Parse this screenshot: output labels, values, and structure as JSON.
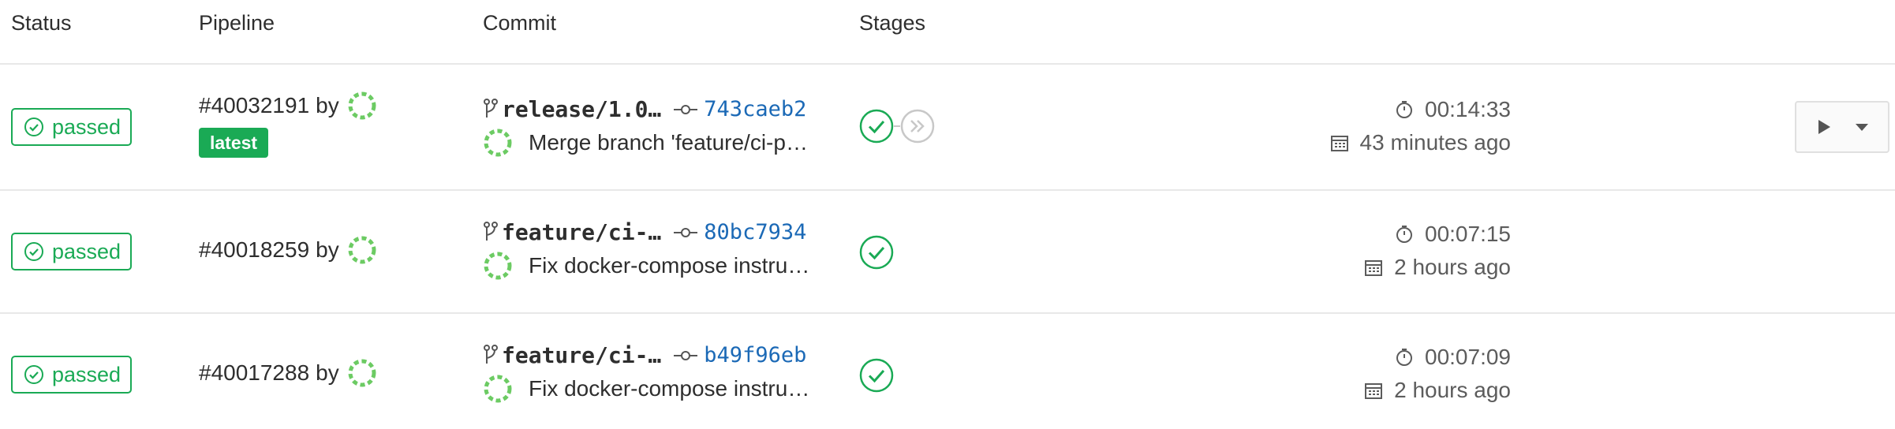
{
  "headers": {
    "status": "Status",
    "pipeline": "Pipeline",
    "commit": "Commit",
    "stages": "Stages"
  },
  "colors": {
    "success": "#1aaa55",
    "link": "#1b69b6",
    "muted": "#5c5c5c",
    "border": "#e8e8e8"
  },
  "rows": [
    {
      "status": "passed",
      "pipeline_id": "#40032191",
      "by": "by",
      "latest_label": "latest",
      "branch": "release/1.0…",
      "sha": "743caeb2",
      "message": "Merge branch 'feature/ci-p…",
      "stages": [
        "passed",
        "skipped"
      ],
      "duration": "00:14:33",
      "finished": "43 minutes ago"
    },
    {
      "status": "passed",
      "pipeline_id": "#40018259",
      "by": "by",
      "branch": "feature/ci-…",
      "sha": "80bc7934",
      "message": "Fix docker-compose instru…",
      "stages": [
        "passed"
      ],
      "duration": "00:07:15",
      "finished": "2 hours ago"
    },
    {
      "status": "passed",
      "pipeline_id": "#40017288",
      "by": "by",
      "branch": "feature/ci-…",
      "sha": "b49f96eb",
      "message": "Fix docker-compose instru…",
      "stages": [
        "passed"
      ],
      "duration": "00:07:09",
      "finished": "2 hours ago"
    }
  ],
  "icons": {
    "status": "check-circle-icon",
    "branch": "branch-icon",
    "commit": "commit-icon",
    "duration": "timer-icon",
    "finished": "calendar-icon",
    "play": "play-icon",
    "dropdown": "caret-down-icon"
  }
}
